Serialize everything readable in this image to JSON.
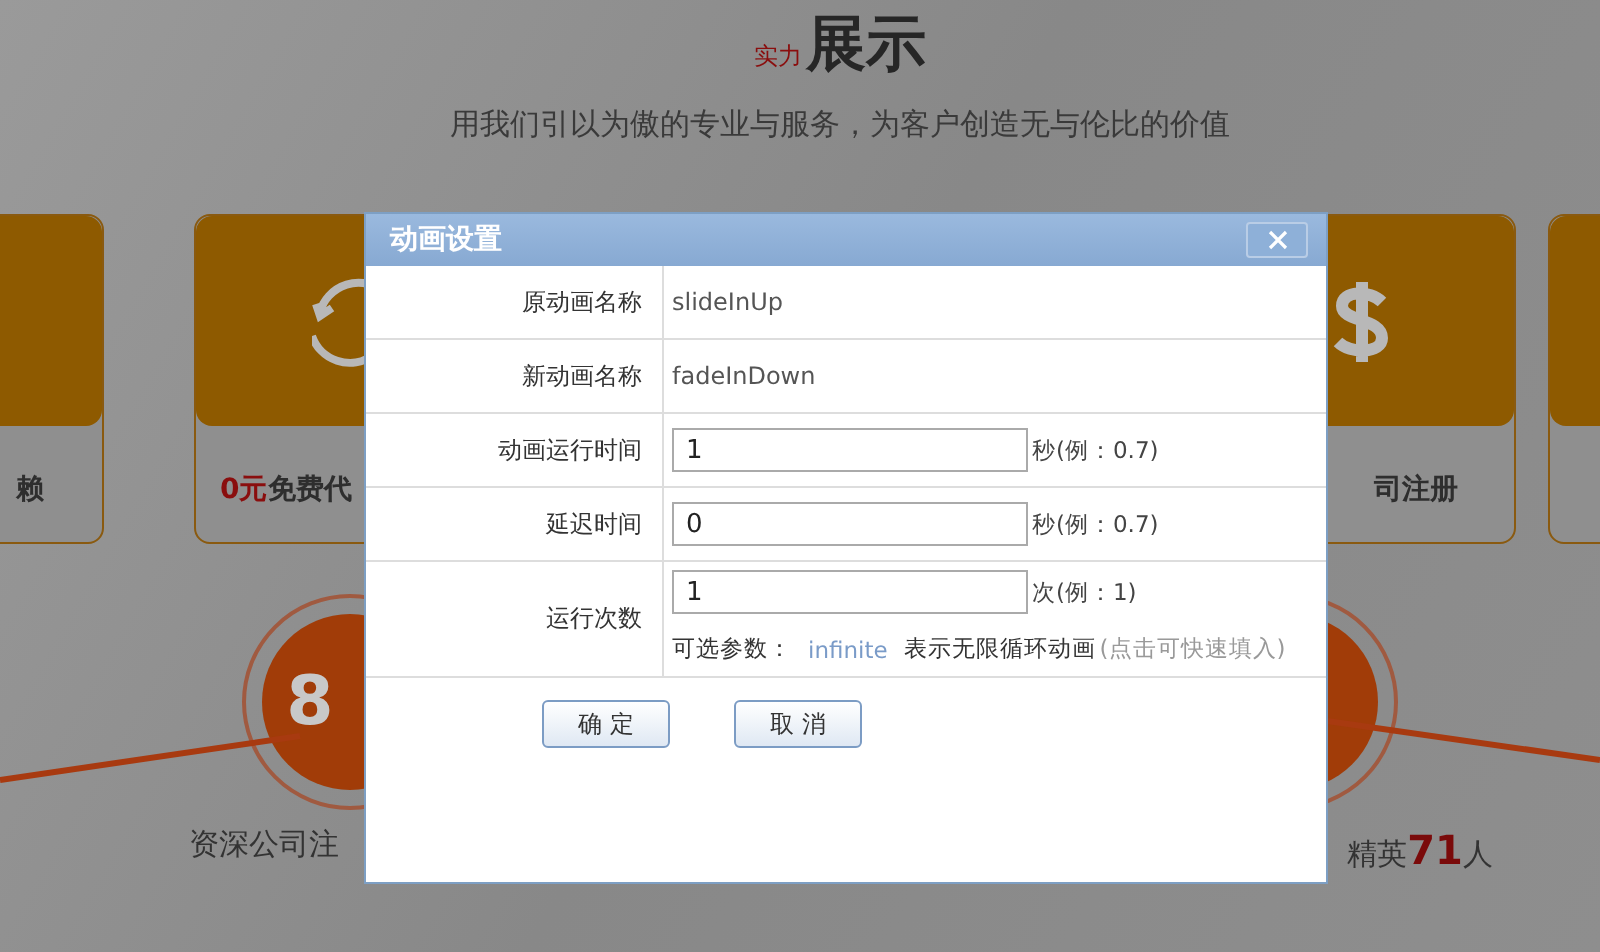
{
  "page": {
    "heading_small": "实力",
    "heading": "展示",
    "subtitle": "用我们引以为傲的专业与服务，为客户创造无与伦比的价值",
    "cards": [
      {
        "text": "赖"
      },
      {
        "highlight": "0元",
        "text": "免费代"
      },
      {
        "text": "司注册"
      }
    ],
    "stats": [
      {
        "number": "8",
        "caption": "资深公司注"
      },
      {
        "caption": "精英",
        "count": "71",
        "unit": "人"
      }
    ]
  },
  "dialog": {
    "title": "动画设置",
    "fields": [
      {
        "kind": "text",
        "label": "原动画名称",
        "value": "slideInUp"
      },
      {
        "kind": "text",
        "label": "新动画名称",
        "value": "fadeInDown"
      },
      {
        "kind": "input",
        "label": "动画运行时间",
        "value": "1",
        "hint": "秒(例：0.7)"
      },
      {
        "kind": "input",
        "label": "延迟时间",
        "value": "0",
        "hint": "秒(例：0.7)"
      },
      {
        "kind": "input",
        "label": "运行次数",
        "value": "1",
        "hint": "次(例：1)",
        "options": {
          "prefix": "可选参数：",
          "link": "infinite",
          "desc": "表示无限循环动画",
          "note": "(点击可快速填入)"
        }
      }
    ],
    "buttons": [
      "确 定",
      "取 消"
    ]
  }
}
